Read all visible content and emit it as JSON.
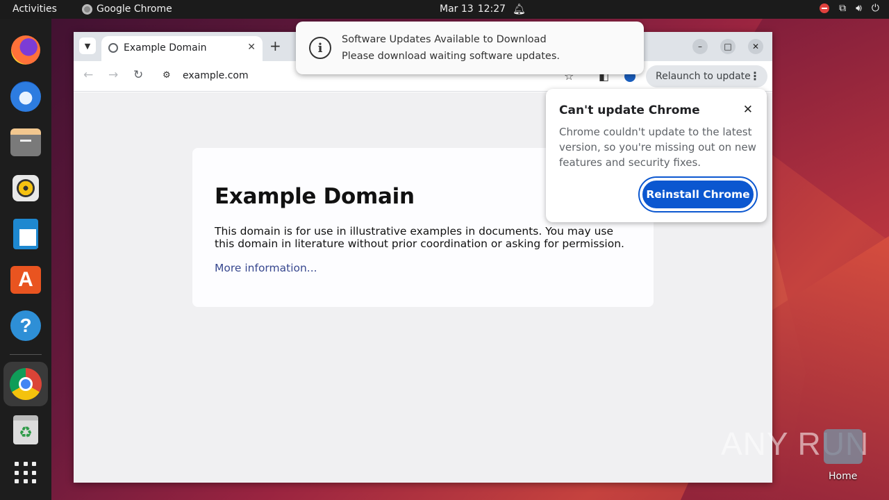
{
  "topbar": {
    "activities": "Activities",
    "app_name": "Google Chrome",
    "date": "Mar 13",
    "time": "12:27"
  },
  "dock": {
    "items": [
      "firefox",
      "thunderbird",
      "files",
      "rhythmbox",
      "libreoffice-writer",
      "app-center",
      "help",
      "google-chrome",
      "trash",
      "show-apps"
    ]
  },
  "browser": {
    "tab_title": "Example Domain",
    "url": "example.com",
    "relaunch_label": "Relaunch to update"
  },
  "page": {
    "heading": "Example Domain",
    "paragraph": "This domain is for use in illustrative examples in documents. You may use this domain in literature without prior coordination or asking for permission.",
    "link": "More information..."
  },
  "popup": {
    "title": "Can't update Chrome",
    "body": "Chrome couldn't update to the latest version, so you're missing out on new features and security fixes.",
    "button": "Reinstall Chrome"
  },
  "notification": {
    "title": "Software Updates Available to Download",
    "body": "Please download waiting software updates."
  },
  "desktop": {
    "home_label": "Home",
    "watermark": "ANY RUN"
  }
}
